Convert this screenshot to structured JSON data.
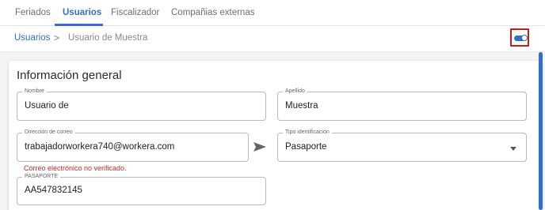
{
  "tabs": [
    {
      "label": "Feriados"
    },
    {
      "label": "Usuarios"
    },
    {
      "label": "Fiscalizador"
    },
    {
      "label": "Compañias externas"
    }
  ],
  "active_tab": "Usuarios",
  "breadcrumb": {
    "link": "Usuarios",
    "separator": ">",
    "current": "Usuario de Muestra"
  },
  "toggle": {
    "state": "on",
    "icon": "toggle-on-icon"
  },
  "section": {
    "title": "Información general"
  },
  "form": {
    "nombre": {
      "label": "Nombre",
      "value": "Usuario de"
    },
    "apellido": {
      "label": "Apellido",
      "value": "Muestra"
    },
    "correo": {
      "label": "Dirección de correo",
      "value": "trabajadorworkera740@workera.com",
      "error": "Correo electrónico no verificado."
    },
    "tipo": {
      "label": "Tipo identificación",
      "value": "Pasaporte"
    },
    "pasaporte": {
      "label": "PASAPORTE",
      "value": "AA547832145"
    }
  },
  "colors": {
    "accent": "#2f6fd1",
    "error": "#c62828",
    "highlight_border": "#c31d1d"
  }
}
